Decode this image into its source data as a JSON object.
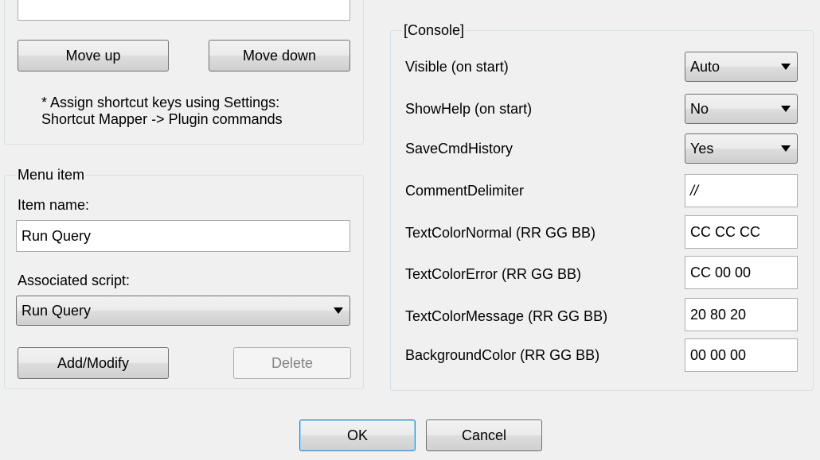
{
  "left": {
    "move_up": "Move up",
    "move_down": "Move down",
    "hint_line1": "* Assign shortcut keys using Settings:",
    "hint_line2": "Shortcut Mapper -> Plugin commands",
    "menu_item_group": "Menu item",
    "item_name_label": "Item name:",
    "item_name_value": "Run Query",
    "associated_script_label": "Associated script:",
    "associated_script_value": "Run Query",
    "add_modify": "Add/Modify",
    "delete": "Delete"
  },
  "console": {
    "group_title": "[Console]",
    "rows": [
      {
        "label": "Visible (on start)",
        "value": "Auto"
      },
      {
        "label": "ShowHelp (on start)",
        "value": "No"
      },
      {
        "label": "SaveCmdHistory",
        "value": "Yes"
      },
      {
        "label": "CommentDelimiter",
        "value": "//"
      },
      {
        "label": "TextColorNormal (RR GG BB)",
        "value": "CC CC CC"
      },
      {
        "label": "TextColorError (RR GG BB)",
        "value": "CC 00 00"
      },
      {
        "label": "TextColorMessage (RR GG BB)",
        "value": "20 80 20"
      },
      {
        "label": "BackgroundColor (RR GG BB)",
        "value": "00 00 00"
      }
    ]
  },
  "footer": {
    "ok": "OK",
    "cancel": "Cancel"
  }
}
